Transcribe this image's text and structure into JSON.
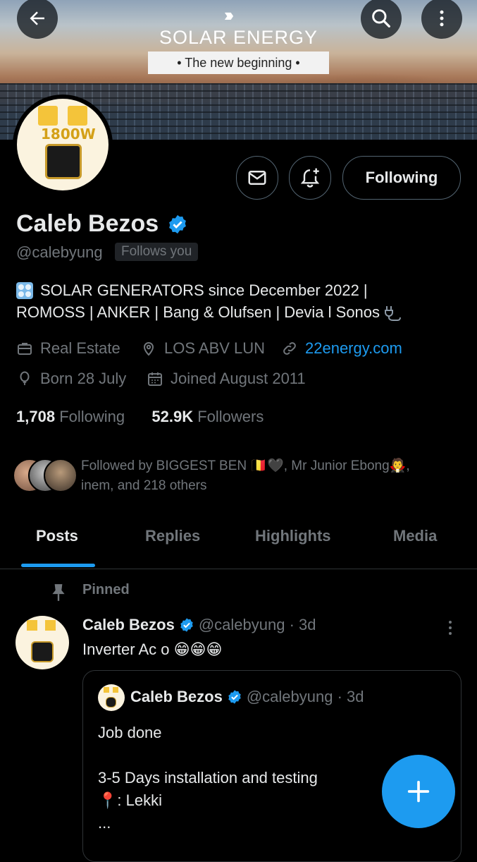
{
  "banner": {
    "brand": "SOLAR ENERGY",
    "tagline": "• The new beginning •",
    "avatar_label": "1800W"
  },
  "nav": {
    "back_icon": "arrow-left-icon",
    "search_icon": "search-icon",
    "more_icon": "more-vertical-icon"
  },
  "actions": {
    "message_icon": "envelope-icon",
    "notify_icon": "bell-plus-icon",
    "following_label": "Following"
  },
  "profile": {
    "name": "Caleb Bezos",
    "handle": "@calebyung",
    "follows_you": "Follows you",
    "bio_line1": "SOLAR GENERATORS since December 2022  |",
    "bio_line2": "ROMOSS | ANKER |  Bang & Olufsen | Devia l Sonos",
    "category": "Real Estate",
    "location": "LOS ABV LUN",
    "website": "22energy.com",
    "birthday": "Born 28 July",
    "joined": "Joined August 2011",
    "following_count": "1,708",
    "following_label": "Following",
    "followers_count": "52.9K",
    "followers_label": "Followers",
    "followed_by_line1": "Followed by BIGGEST BEN 🇧🇪🖤, Mr Junior Ebong🧛,",
    "followed_by_line2": "inem, and 218 others"
  },
  "tabs": [
    "Posts",
    "Replies",
    "Highlights",
    "Media"
  ],
  "post": {
    "pinned_label": "Pinned",
    "author": "Caleb Bezos",
    "meta": "@calebyung · 3d",
    "text": "Inverter Ac o 😁😁😁",
    "quote": {
      "author": "Caleb Bezos",
      "meta": "@calebyung · 3d",
      "text": "Job done\n\n3-5 Days installation and testing\n📍: Lekki\n..."
    }
  },
  "fab_icon": "plus-icon",
  "colors": {
    "accent": "#1d9bf0",
    "background": "#000000",
    "secondary_text": "#71767b"
  }
}
